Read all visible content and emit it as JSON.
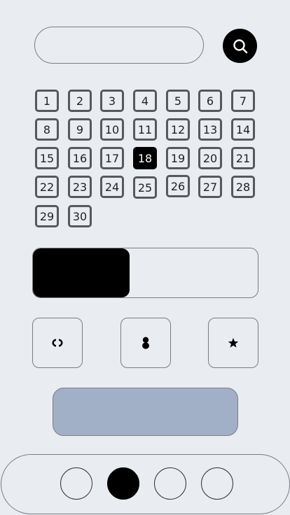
{
  "search": {
    "value": "",
    "placeholder": ""
  },
  "calendar": {
    "days": [
      "1",
      "2",
      "3",
      "4",
      "5",
      "6",
      "7",
      "8",
      "9",
      "10",
      "11",
      "12",
      "13",
      "14",
      "15",
      "16",
      "17",
      "18",
      "19",
      "20",
      "21",
      "22",
      "23",
      "24",
      "25",
      "26",
      "27",
      "28",
      "29",
      "30"
    ],
    "selected_day": "18"
  },
  "progress": {
    "fraction": 0.43
  },
  "tiles": [
    {
      "icon": "link-icon"
    },
    {
      "icon": "figure-eight-icon"
    },
    {
      "icon": "star-icon"
    }
  ],
  "action_button": {
    "label": ""
  },
  "page_indicator": {
    "count": 4,
    "active_index": 1
  },
  "colors": {
    "background": "#e9edf2",
    "accent": "#000000",
    "action_button": "#a2b0c7",
    "border": "#7a7d82"
  }
}
